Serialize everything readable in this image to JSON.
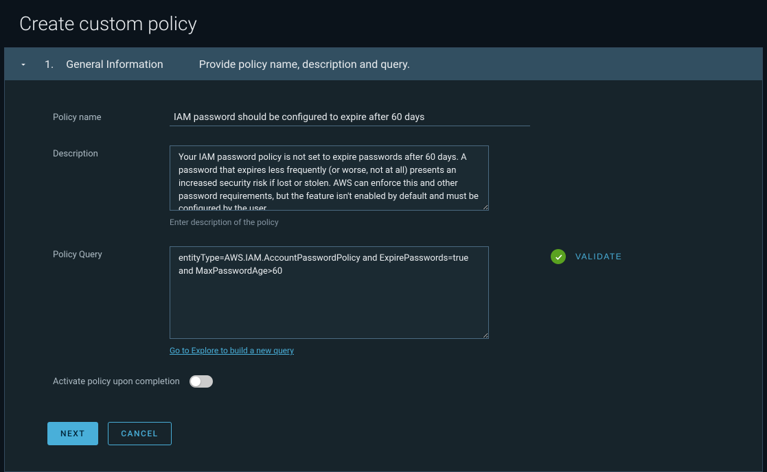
{
  "page_title": "Create custom policy",
  "step": {
    "number": "1.",
    "title": "General Information",
    "subtitle": "Provide policy name, description and query."
  },
  "form": {
    "policy_name_label": "Policy name",
    "policy_name_value": "IAM password should be configured to expire after 60 days",
    "description_label": "Description",
    "description_value": "Your IAM password policy is not set to expire passwords after 60 days. A password that expires less frequently (or worse, not at all) presents an increased security risk if lost or stolen. AWS can enforce this and other password requirements, but the feature isn't enabled by default and must be configured by the user.",
    "description_helper": "Enter description of the policy",
    "policy_query_label": "Policy Query",
    "policy_query_value": "entityType=AWS.IAM.AccountPasswordPolicy and ExpirePasswords=true and MaxPasswordAge>60",
    "query_link": "Go to Explore to build a new query",
    "validate_label": "VALIDATE",
    "activate_label": "Activate policy upon completion"
  },
  "buttons": {
    "next": "NEXT",
    "cancel": "CANCEL"
  }
}
